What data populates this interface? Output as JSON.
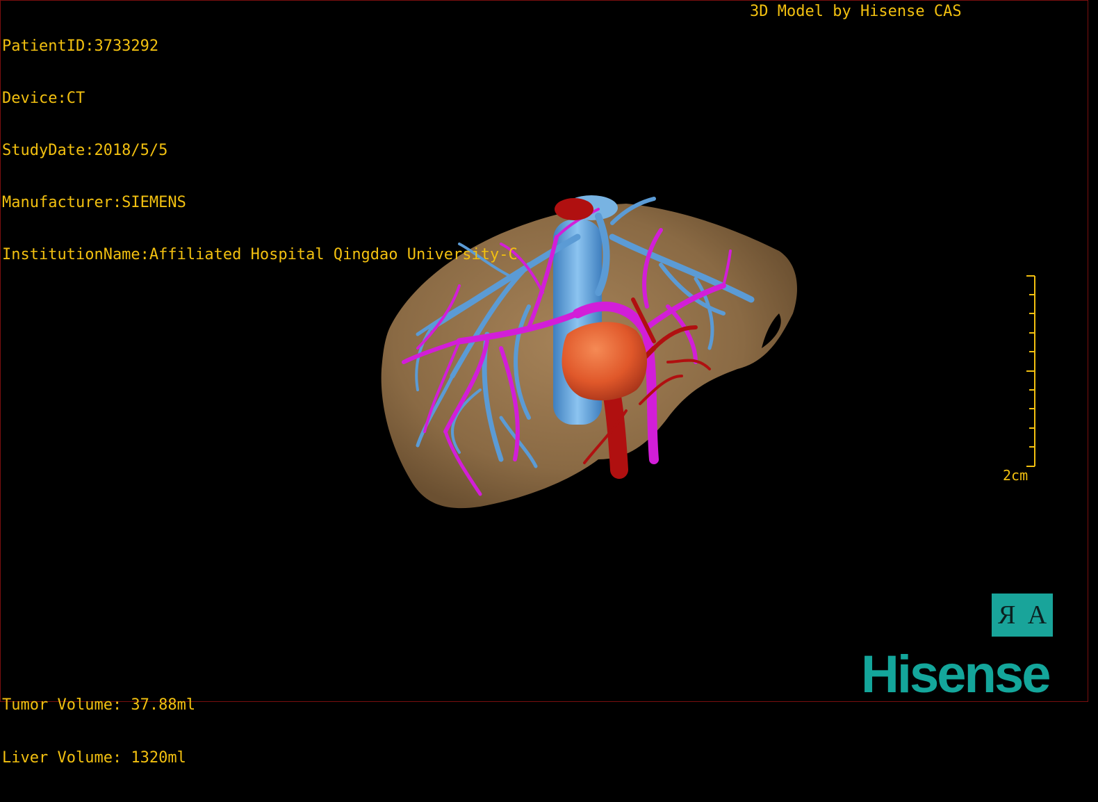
{
  "header": {
    "patient_id": "PatientID:3733292",
    "device": "Device:CT",
    "study_date": "StudyDate:2018/5/5",
    "manufacturer": "Manufacturer:SIEMENS",
    "institution": "InstitutionName:Affiliated Hospital Qingdao University-C",
    "model_credit": "3D Model by Hisense CAS"
  },
  "volumes": {
    "tumor": "Tumor Volume: 37.88ml",
    "liver": "Liver Volume: 1320ml"
  },
  "scale": {
    "label": "2cm"
  },
  "orientation": {
    "left_glyph": "R",
    "right_glyph": "A"
  },
  "brand": {
    "logo_text": "Hisense"
  },
  "colors": {
    "overlay_text": "#f2c010",
    "liver": "#8a6a44",
    "hepatic_vein": "#5b9bd5",
    "portal_vein": "#d21ed8",
    "artery": "#b01010",
    "tumor": "#e0582a",
    "brand": "#14a69b"
  },
  "icons": [
    "orientation-cube-icon",
    "hisense-logo-icon"
  ]
}
